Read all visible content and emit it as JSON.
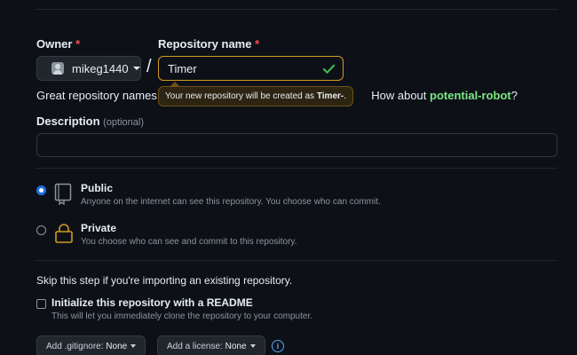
{
  "owner": {
    "label": "Owner",
    "required_mark": "*",
    "value": "mikeg1440"
  },
  "separator": "/",
  "repo_name": {
    "label": "Repository name",
    "required_mark": "*",
    "value": "Timer"
  },
  "hint": {
    "prefix": "Great repository names are",
    "suffix": "How about",
    "suggestion": "potential-robot",
    "end": "?"
  },
  "tooltip": {
    "prefix": "Your new repository will be created as",
    "name": "Timer-",
    "end": "."
  },
  "description": {
    "label": "Description",
    "optional": "(optional)",
    "value": ""
  },
  "visibility": {
    "public": {
      "title": "Public",
      "subtitle": "Anyone on the internet can see this repository. You choose who can commit.",
      "selected": true
    },
    "private": {
      "title": "Private",
      "subtitle": "You choose who can see and commit to this repository.",
      "selected": false
    }
  },
  "skip_text": "Skip this step if you're importing an existing repository.",
  "readme": {
    "label": "Initialize this repository with a README",
    "subtitle": "This will let you immediately clone the repository to your computer.",
    "checked": false
  },
  "gitignore": {
    "prefix": "Add .gitignore:",
    "value": "None"
  },
  "license": {
    "prefix": "Add a license:",
    "value": "None"
  },
  "icons": {
    "public": "repo-book-icon",
    "private": "lock-icon",
    "info": "info-icon",
    "valid": "check-icon",
    "avatar": "avatar"
  },
  "colors": {
    "background": "#0d1117",
    "accent_blue": "#1f6feb",
    "success_green": "#7ee787",
    "warning_border": "#d29922",
    "required_red": "#f85149"
  }
}
